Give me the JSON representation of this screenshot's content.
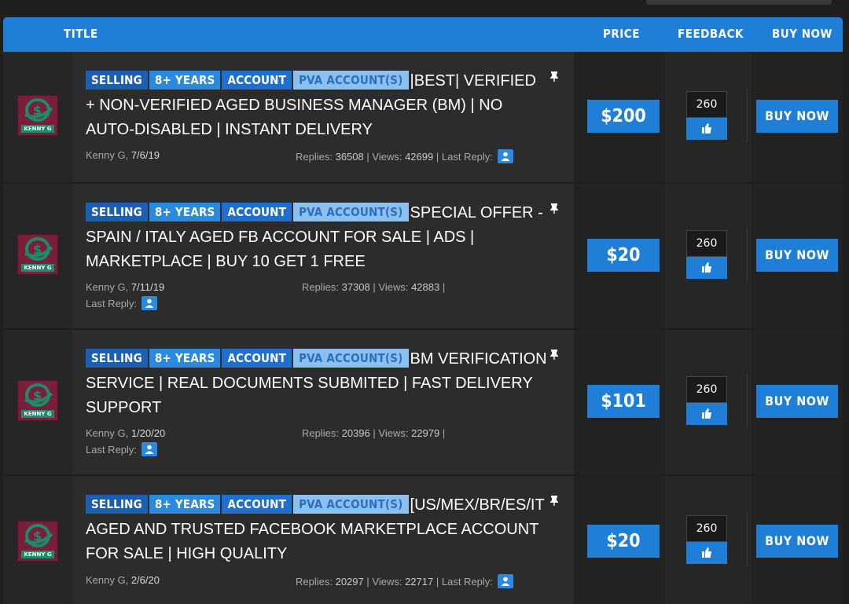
{
  "columns": {
    "title": "TITLE",
    "price": "PRICE",
    "feedback": "FEEDBACK",
    "buy_now": "BUY NOW"
  },
  "colors": {
    "header": "#1f7fd6",
    "tag_selling": "#1a5fb4",
    "tag_years": "#2a8ae0",
    "tag_account": "#1f6fcf",
    "tag_pva": "#8cc0ee"
  },
  "avatar_label": "KENNY G",
  "stats_labels": {
    "replies": "Replies:",
    "views": "Views:",
    "last_reply": "Last Reply:",
    "sep": "|"
  },
  "rows": [
    {
      "tags": [
        "SELLING",
        "8+ YEARS",
        "ACCOUNT",
        "PVA ACCOUNT(S)"
      ],
      "title": "|BEST| VERIFIED + NON-VERIFIED AGED BUSINESS MANAGER (BM) | NO AUTO-DISABLED | INSTANT DELIVERY",
      "author": "Kenny G,",
      "date": "7/6/19",
      "replies": "36508",
      "views": "42699",
      "price": "$200",
      "feedback": "260",
      "buy_label": "BUY NOW"
    },
    {
      "tags": [
        "SELLING",
        "8+ YEARS",
        "ACCOUNT",
        "PVA ACCOUNT(S)"
      ],
      "title": "SPECIAL OFFER - SPAIN / ITALY AGED FB ACCOUNT FOR SALE | ADS | MARKETPLACE | BUY 10 GET 1 FREE",
      "author": "Kenny G,",
      "date": "7/11/19",
      "replies": "37308",
      "views": "42883",
      "price": "$20",
      "feedback": "260",
      "buy_label": "BUY NOW"
    },
    {
      "tags": [
        "SELLING",
        "8+ YEARS",
        "ACCOUNT",
        "PVA ACCOUNT(S)"
      ],
      "title": "BM VERIFICATION SERVICE | REAL DOCUMENTS SUBMITED | FAST DELIVERY SUPPORT",
      "author": "Kenny G,",
      "date": "1/20/20",
      "replies": "20396",
      "views": "22979",
      "price": "$101",
      "feedback": "260",
      "buy_label": "BUY NOW"
    },
    {
      "tags": [
        "SELLING",
        "8+ YEARS",
        "ACCOUNT",
        "PVA ACCOUNT(S)"
      ],
      "title": "[US/MEX/BR/ES/IT AGED AND TRUSTED FACEBOOK MARKETPLACE ACCOUNT FOR SALE | HIGH QUALITY",
      "author": "Kenny G,",
      "date": "2/6/20",
      "replies": "20297",
      "views": "22717",
      "price": "$20",
      "feedback": "260",
      "buy_label": "BUY NOW"
    }
  ]
}
